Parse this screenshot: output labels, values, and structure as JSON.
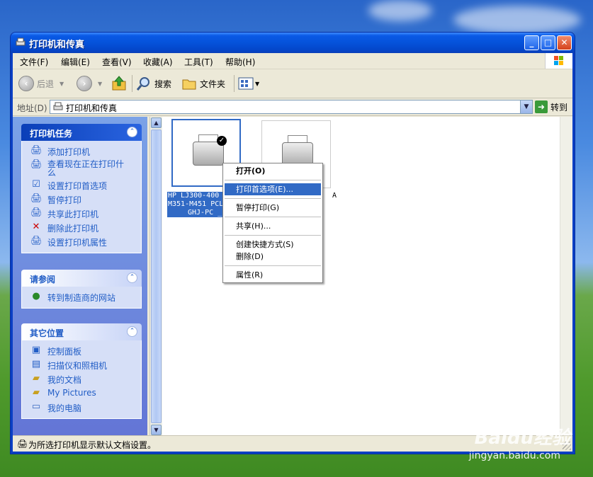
{
  "window": {
    "title": "打印机和传真"
  },
  "menu": [
    "文件(F)",
    "编辑(E)",
    "查看(V)",
    "收藏(A)",
    "工具(T)",
    "帮助(H)"
  ],
  "toolbar": {
    "back": "后退",
    "search": "搜索",
    "folders": "文件夹"
  },
  "address": {
    "label": "地址(D)",
    "value": "打印机和传真",
    "go": "转到"
  },
  "task_groups": [
    {
      "title": "打印机任务",
      "items": [
        {
          "label": "添加打印机",
          "icon": "add-printer-icon"
        },
        {
          "label": "查看现在正在打印什",
          "label2": "么",
          "icon": "print-queue-icon"
        },
        {
          "label": "设置打印首选项",
          "icon": "preferences-icon"
        },
        {
          "label": "暂停打印",
          "icon": "pause-icon"
        },
        {
          "label": "共享此打印机",
          "icon": "share-icon"
        },
        {
          "label": "删除此打印机",
          "icon": "delete-icon"
        },
        {
          "label": "设置打印机属性",
          "icon": "properties-icon"
        }
      ]
    },
    {
      "title": "请参阅",
      "items": [
        {
          "label": "转到制造商的网站",
          "icon": "web-icon"
        }
      ]
    },
    {
      "title": "其它位置",
      "items": [
        {
          "label": "控制面板",
          "icon": "control-panel-icon"
        },
        {
          "label": "扫描仪和照相机",
          "icon": "scanner-icon"
        },
        {
          "label": "我的文档",
          "icon": "my-documents-icon"
        },
        {
          "label": "My Pictures",
          "icon": "my-pictures-icon"
        },
        {
          "label": "我的电脑",
          "icon": "my-computer-icon"
        }
      ]
    }
  ],
  "printers": [
    {
      "label_line1": "HP LJ300-400",
      "label_line2": "M351-M451 PCL",
      "label_line3": "GHJ-PC _I",
      "default": true
    },
    {
      "label_tail": "A"
    }
  ],
  "context_menu": [
    "打开(O)",
    "打印首选项(E)...",
    "暂停打印(G)",
    "共享(H)...",
    "创建快捷方式(S)",
    "删除(D)",
    "属性(R)"
  ],
  "status": {
    "text": "为所选打印机显示默认文档设置。"
  },
  "watermark": {
    "brand": "Baidu经验",
    "url": "jingyan.baidu.com"
  }
}
